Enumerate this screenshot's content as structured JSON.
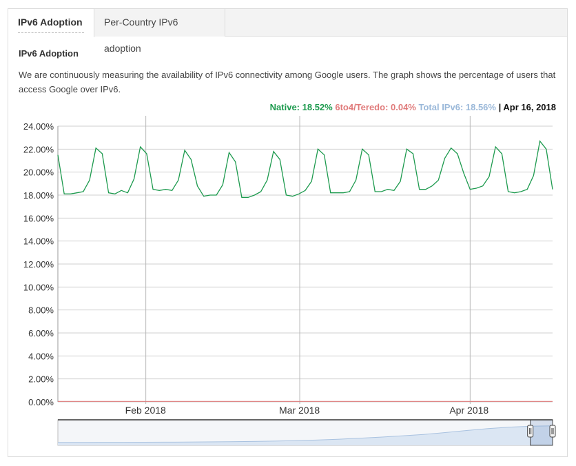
{
  "tabs": [
    {
      "label": "IPv6 Adoption",
      "active": true
    },
    {
      "label": "Per-Country IPv6 adoption",
      "active": false
    }
  ],
  "section_title": "IPv6 Adoption",
  "description": "We are continuously measuring the availability of IPv6 connectivity among Google users. The graph shows the percentage of users that access Google over IPv6.",
  "legend": {
    "native": "Native: 18.52%",
    "teredo": "6to4/Teredo: 0.04%",
    "total": "Total IPv6: 18.56%",
    "separator": "|",
    "date": "Apr 16, 2018"
  },
  "colors": {
    "native": "#1d9a4e",
    "teredo": "#e07b7b",
    "total": "#9ab8d9",
    "grid": "#cfcfcf",
    "navigator_fill": "#dbe6f3",
    "navigator_line": "#a9c2e0"
  },
  "chart_data": {
    "type": "line",
    "x_start": "2018-01-16",
    "x_end": "2018-04-16",
    "ylim": [
      0,
      24
    ],
    "y_ticks": [
      "0.00%",
      "2.00%",
      "4.00%",
      "6.00%",
      "8.00%",
      "10.00%",
      "12.00%",
      "14.00%",
      "16.00%",
      "18.00%",
      "20.00%",
      "22.00%",
      "24.00%"
    ],
    "y_tick_values": [
      0,
      2,
      4,
      6,
      8,
      10,
      12,
      14,
      16,
      18,
      20,
      22,
      24
    ],
    "x_ticks": [
      {
        "label": "Feb 2018",
        "date": "2018-02-01"
      },
      {
        "label": "Mar 2018",
        "date": "2018-03-01"
      },
      {
        "label": "Apr 2018",
        "date": "2018-04-01"
      }
    ],
    "grid": true,
    "series": [
      {
        "name": "Native",
        "values": [
          21.5,
          18.1,
          18.1,
          18.2,
          18.3,
          19.3,
          22.1,
          21.6,
          18.2,
          18.1,
          18.4,
          18.2,
          19.4,
          22.2,
          21.6,
          18.5,
          18.4,
          18.5,
          18.4,
          19.3,
          21.9,
          21.1,
          18.8,
          17.9,
          18.0,
          18.0,
          18.9,
          21.7,
          20.9,
          17.8,
          17.8,
          18.0,
          18.3,
          19.3,
          21.8,
          21.1,
          18.0,
          17.9,
          18.1,
          18.4,
          19.2,
          22.0,
          21.5,
          18.2,
          18.2,
          18.2,
          18.3,
          19.3,
          22.0,
          21.5,
          18.3,
          18.3,
          18.5,
          18.4,
          19.2,
          22.0,
          21.6,
          18.5,
          18.5,
          18.8,
          19.3,
          21.2,
          22.1,
          21.6,
          19.9,
          18.5,
          18.6,
          18.8,
          19.6,
          22.2,
          21.6,
          18.3,
          18.2,
          18.3,
          18.5,
          19.7,
          22.7,
          22.0,
          18.5
        ]
      },
      {
        "name": "6to4/Teredo",
        "values": [
          0.04,
          0.04,
          0.04,
          0.04,
          0.04,
          0.04,
          0.04,
          0.04,
          0.04,
          0.04,
          0.04,
          0.04,
          0.04,
          0.04,
          0.04,
          0.04,
          0.04,
          0.04,
          0.04,
          0.04,
          0.04,
          0.04,
          0.04,
          0.04,
          0.04,
          0.04,
          0.04,
          0.04,
          0.04,
          0.04,
          0.04,
          0.04,
          0.04,
          0.04,
          0.04,
          0.04,
          0.04,
          0.04,
          0.04,
          0.04,
          0.04,
          0.04,
          0.04,
          0.04,
          0.04,
          0.04,
          0.04,
          0.04,
          0.04,
          0.04,
          0.04,
          0.04,
          0.04,
          0.04,
          0.04,
          0.04,
          0.04,
          0.04,
          0.04,
          0.04,
          0.04,
          0.04,
          0.04,
          0.04,
          0.04,
          0.04,
          0.04,
          0.04,
          0.04,
          0.04,
          0.04,
          0.04,
          0.04,
          0.04,
          0.04,
          0.04,
          0.04,
          0.04,
          0.04
        ]
      }
    ],
    "navigator": {
      "values": [
        0.2,
        0.2,
        0.3,
        0.3,
        0.4,
        0.5,
        0.6,
        0.8,
        1.0,
        1.3,
        1.7,
        2.3,
        3.0,
        4.0,
        5.2,
        6.5,
        8.0,
        9.8,
        12.0,
        14.5,
        16.8,
        18.5,
        19.6,
        20.1
      ],
      "window_start_fraction": 0.955,
      "window_end_fraction": 1.0
    }
  }
}
